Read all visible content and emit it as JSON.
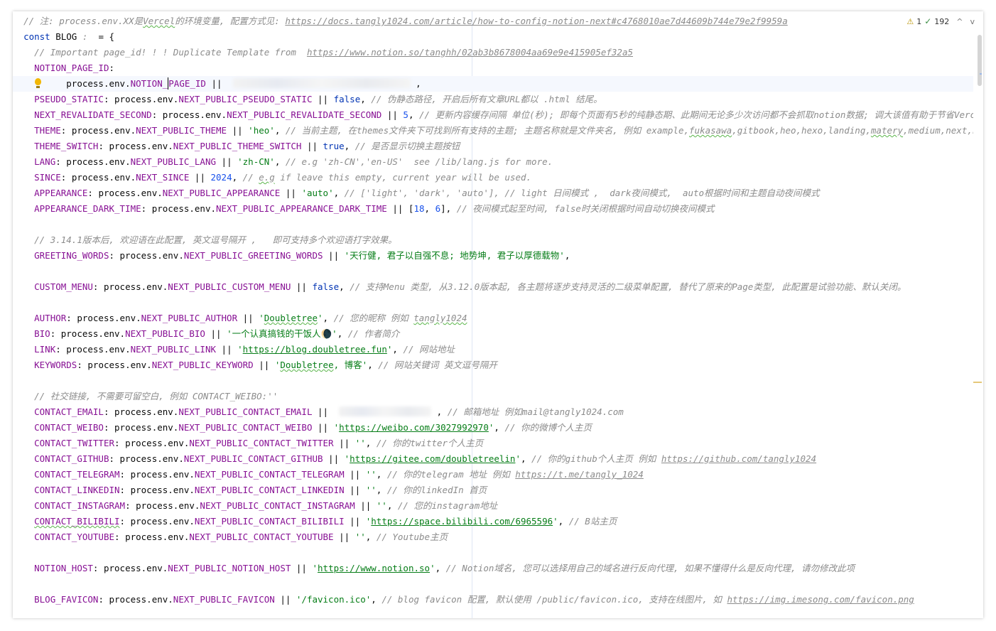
{
  "inspection": {
    "warnings": "1",
    "weak_warnings": "192",
    "prev_label": "^",
    "next_label": "v"
  },
  "lines": [
    [
      [
        "c",
        "// 注: process.env.XX是"
      ],
      [
        "c sq",
        "Vercel"
      ],
      [
        "c",
        "的环境变量, 配置方式见: "
      ],
      [
        "c u",
        "https://docs.tangly1024.com/article/how-to-config-notion-next#c4768010ae7d44609b744e79e2f9959a"
      ]
    ],
    [
      [
        "k",
        "const "
      ],
      [
        "",
        "BLOG "
      ],
      [
        "c",
        ":  "
      ],
      [
        "",
        "= {"
      ]
    ],
    [
      [
        "",
        "  "
      ],
      [
        "c",
        "// Important page_id! ! ! Duplicate Template from  "
      ],
      [
        "c u",
        "https://www.notion.so/tanghh/02ab3b8678004aa69e9e415905ef32a5"
      ]
    ],
    [
      [
        "",
        "  "
      ],
      [
        "p",
        "NOTION_PAGE_ID"
      ],
      [
        "",
        ":"
      ]
    ],
    [
      [
        "",
        "        process.env."
      ],
      [
        "p",
        "NOTION_"
      ],
      [
        "caret",
        ""
      ],
      [
        "p",
        "PAGE_ID"
      ],
      [
        "",
        " ||  "
      ],
      [
        "blur",
        ""
      ],
      [
        "",
        " ,"
      ]
    ],
    [
      [
        "",
        "  "
      ],
      [
        "p",
        "PSEUDO_STATIC"
      ],
      [
        "",
        ": process.env."
      ],
      [
        "p",
        "NEXT_PUBLIC_PSEUDO_STATIC"
      ],
      [
        "",
        " || "
      ],
      [
        "k",
        "false"
      ],
      [
        "",
        ", "
      ],
      [
        "c",
        "// 伪静态路径, 开启后所有文章URL都以 .html 结尾。"
      ]
    ],
    [
      [
        "",
        "  "
      ],
      [
        "p",
        "NEXT_REVALIDATE_SECOND"
      ],
      [
        "",
        ": process.env."
      ],
      [
        "p",
        "NEXT_PUBLIC_REVALIDATE_SECOND"
      ],
      [
        "",
        " || "
      ],
      [
        "n",
        "5"
      ],
      [
        "",
        ", "
      ],
      [
        "c",
        "// 更新内容缓存间隔 单位(秒); 即每个页面有5秒的纯静态期、此期间无论多少次访问都不会抓取notion数据; 调大该值有助于节省Vercel资源、同时提升访问速率, 但也会使文章更新有延迟。"
      ]
    ],
    [
      [
        "",
        "  "
      ],
      [
        "p",
        "THEME"
      ],
      [
        "",
        ": process.env."
      ],
      [
        "p",
        "NEXT_PUBLIC_THEME"
      ],
      [
        "",
        " || "
      ],
      [
        "s",
        "'heo'"
      ],
      [
        "",
        ", "
      ],
      [
        "c",
        "// 当前主题, 在themes文件夹下可找到所有支持的主题; 主题名称就是文件夹名, 例如 example,"
      ],
      [
        "c sq",
        "fukasawa"
      ],
      [
        "c",
        ",gitbook,heo,hexo,landing,"
      ],
      [
        "c sq",
        "matery"
      ],
      [
        "c",
        ",medium,next,nobelium,plog,simple"
      ]
    ],
    [
      [
        "",
        "  "
      ],
      [
        "p",
        "THEME_SWITCH"
      ],
      [
        "",
        ": process.env."
      ],
      [
        "p",
        "NEXT_PUBLIC_THEME_SWITCH"
      ],
      [
        "",
        " || "
      ],
      [
        "k",
        "true"
      ],
      [
        "",
        ", "
      ],
      [
        "c",
        "// 是否显示切换主题按钮"
      ]
    ],
    [
      [
        "",
        "  "
      ],
      [
        "p",
        "LANG"
      ],
      [
        "",
        ": process.env."
      ],
      [
        "p",
        "NEXT_PUBLIC_LANG"
      ],
      [
        "",
        " || "
      ],
      [
        "s",
        "'zh-CN'"
      ],
      [
        "",
        ", "
      ],
      [
        "c",
        "// e.g 'zh-CN','en-US'  see /lib/lang.js for more."
      ]
    ],
    [
      [
        "",
        "  "
      ],
      [
        "p",
        "SINCE"
      ],
      [
        "",
        ": process.env."
      ],
      [
        "p",
        "NEXT_SINCE"
      ],
      [
        "",
        " || "
      ],
      [
        "n",
        "2024"
      ],
      [
        "",
        ", "
      ],
      [
        "c",
        "// "
      ],
      [
        "c sq",
        "e.g"
      ],
      [
        "c",
        " if leave this empty, current year will be used."
      ]
    ],
    [
      [
        "",
        "  "
      ],
      [
        "p",
        "APPEARANCE"
      ],
      [
        "",
        ": process.env."
      ],
      [
        "p",
        "NEXT_PUBLIC_APPEARANCE"
      ],
      [
        "",
        " || "
      ],
      [
        "s",
        "'auto'"
      ],
      [
        "",
        ", "
      ],
      [
        "c",
        "// ['light', 'dark', 'auto'], // light 日间模式 ,  dark夜间模式,  auto根据时间和主题自动夜间模式"
      ]
    ],
    [
      [
        "",
        "  "
      ],
      [
        "p",
        "APPEARANCE_DARK_TIME"
      ],
      [
        "",
        ": process.env."
      ],
      [
        "p",
        "NEXT_PUBLIC_APPEARANCE_DARK_TIME"
      ],
      [
        "",
        " || ["
      ],
      [
        "n",
        "18"
      ],
      [
        "",
        ", "
      ],
      [
        "n",
        "6"
      ],
      [
        "",
        "], "
      ],
      [
        "c",
        "// 夜间模式起至时间, false时关闭根据时间自动切换夜间模式"
      ]
    ],
    [],
    [
      [
        "",
        "  "
      ],
      [
        "c",
        "// 3.14.1版本后, 欢迎语在此配置, 英文逗号隔开 ,   即可支持多个欢迎语打字效果。"
      ]
    ],
    [
      [
        "",
        "  "
      ],
      [
        "p",
        "GREETING_WORDS"
      ],
      [
        "",
        ": process.env."
      ],
      [
        "p",
        "NEXT_PUBLIC_GREETING_WORDS"
      ],
      [
        "",
        " || "
      ],
      [
        "s",
        "'天行健, 君子以自强不息; 地势坤, 君子以厚德载物'"
      ],
      [
        "",
        ","
      ]
    ],
    [],
    [
      [
        "",
        "  "
      ],
      [
        "p",
        "CUSTOM_MENU"
      ],
      [
        "",
        ": process.env."
      ],
      [
        "p",
        "NEXT_PUBLIC_CUSTOM_MENU"
      ],
      [
        "",
        " || "
      ],
      [
        "k",
        "false"
      ],
      [
        "",
        ", "
      ],
      [
        "c",
        "// 支持Menu 类型, 从3.12.0版本起, 各主题将逐步支持灵活的二级菜单配置, 替代了原来的Page类型, 此配置是试验功能、默认关闭。"
      ]
    ],
    [],
    [
      [
        "",
        "  "
      ],
      [
        "p",
        "AUTHOR"
      ],
      [
        "",
        ": process.env."
      ],
      [
        "p",
        "NEXT_PUBLIC_AUTHOR"
      ],
      [
        "",
        " || "
      ],
      [
        "s",
        "'"
      ],
      [
        "s sq",
        "Doubletree"
      ],
      [
        "s",
        "'"
      ],
      [
        "",
        ", "
      ],
      [
        "c",
        "// 您的昵称 例如 "
      ],
      [
        "c sq",
        "tangly1024"
      ]
    ],
    [
      [
        "",
        "  "
      ],
      [
        "p",
        "BIO"
      ],
      [
        "",
        ": process.env."
      ],
      [
        "p",
        "NEXT_PUBLIC_BIO"
      ],
      [
        "",
        " || "
      ],
      [
        "s",
        "'一个认真搞钱的干饭人🌘'"
      ],
      [
        "",
        ", "
      ],
      [
        "c",
        "// 作者简介"
      ]
    ],
    [
      [
        "",
        "  "
      ],
      [
        "p",
        "LINK"
      ],
      [
        "",
        ": process.env."
      ],
      [
        "p",
        "NEXT_PUBLIC_LINK"
      ],
      [
        "",
        " || "
      ],
      [
        "s",
        "'"
      ],
      [
        "s u",
        "https://blog.doubletree.fun"
      ],
      [
        "s",
        "'"
      ],
      [
        "",
        ", "
      ],
      [
        "c",
        "// 网站地址"
      ]
    ],
    [
      [
        "",
        "  "
      ],
      [
        "p",
        "KEYWORDS"
      ],
      [
        "",
        ": process.env."
      ],
      [
        "p",
        "NEXT_PUBLIC_KEYWORD"
      ],
      [
        "",
        " || "
      ],
      [
        "s",
        "'"
      ],
      [
        "s sq",
        "Doubletree"
      ],
      [
        "s",
        ", 博客'"
      ],
      [
        "",
        ", "
      ],
      [
        "c",
        "// 网站关键词 英文逗号隔开"
      ]
    ],
    [],
    [
      [
        "",
        "  "
      ],
      [
        "c",
        "// 社交链接, 不需要可留空白, 例如 CONTACT_WEIBO:''"
      ]
    ],
    [
      [
        "",
        "  "
      ],
      [
        "p",
        "CONTACT_EMAIL"
      ],
      [
        "",
        ": process.env."
      ],
      [
        "p",
        "NEXT_PUBLIC_CONTACT_EMAIL"
      ],
      [
        "",
        " ||  "
      ],
      [
        "blur short",
        ""
      ],
      [
        "",
        " , "
      ],
      [
        "c",
        "// 邮箱地址 例如mail@tangly1024.com"
      ]
    ],
    [
      [
        "",
        "  "
      ],
      [
        "p",
        "CONTACT_WEIBO"
      ],
      [
        "",
        ": process.env."
      ],
      [
        "p",
        "NEXT_PUBLIC_CONTACT_WEIBO"
      ],
      [
        "",
        " || "
      ],
      [
        "s",
        "'"
      ],
      [
        "s u",
        "https://weibo.com/3027992970"
      ],
      [
        "s",
        "'"
      ],
      [
        "",
        ", "
      ],
      [
        "c",
        "// 你的微博个人主页"
      ]
    ],
    [
      [
        "",
        "  "
      ],
      [
        "p",
        "CONTACT_TWITTER"
      ],
      [
        "",
        ": process.env."
      ],
      [
        "p",
        "NEXT_PUBLIC_CONTACT_TWITTER"
      ],
      [
        "",
        " || "
      ],
      [
        "s",
        "''"
      ],
      [
        "",
        ", "
      ],
      [
        "c",
        "// 你的twitter个人主页"
      ]
    ],
    [
      [
        "",
        "  "
      ],
      [
        "p",
        "CONTACT_GITHUB"
      ],
      [
        "",
        ": process.env."
      ],
      [
        "p",
        "NEXT_PUBLIC_CONTACT_GITHUB"
      ],
      [
        "",
        " || "
      ],
      [
        "s",
        "'"
      ],
      [
        "s u",
        "https://gitee.com/doubletreelin"
      ],
      [
        "s",
        "'"
      ],
      [
        "",
        ", "
      ],
      [
        "c",
        "// 你的github个人主页 例如 "
      ],
      [
        "c u",
        "https://github.com/tangly1024"
      ]
    ],
    [
      [
        "",
        "  "
      ],
      [
        "p",
        "CONTACT_TELEGRAM"
      ],
      [
        "",
        ": process.env."
      ],
      [
        "p",
        "NEXT_PUBLIC_CONTACT_TELEGRAM"
      ],
      [
        "",
        " || "
      ],
      [
        "s",
        "''"
      ],
      [
        "",
        ", "
      ],
      [
        "c",
        "// 你的telegram 地址 例如 "
      ],
      [
        "c u",
        "https://t.me/tangly_1024"
      ]
    ],
    [
      [
        "",
        "  "
      ],
      [
        "p",
        "CONTACT_LINKEDIN"
      ],
      [
        "",
        ": process.env."
      ],
      [
        "p",
        "NEXT_PUBLIC_CONTACT_LINKEDIN"
      ],
      [
        "",
        " || "
      ],
      [
        "s",
        "''"
      ],
      [
        "",
        ", "
      ],
      [
        "c",
        "// 你的linkedIn 首页"
      ]
    ],
    [
      [
        "",
        "  "
      ],
      [
        "p",
        "CONTACT_INSTAGRAM"
      ],
      [
        "",
        ": process.env."
      ],
      [
        "p",
        "NEXT_PUBLIC_CONTACT_INSTAGRAM"
      ],
      [
        "",
        " || "
      ],
      [
        "s",
        "''"
      ],
      [
        "",
        ", "
      ],
      [
        "c",
        "// 您的instagram地址"
      ]
    ],
    [
      [
        "",
        "  "
      ],
      [
        "p sq",
        "CONTACT_BILIBILI"
      ],
      [
        "",
        ": process.env."
      ],
      [
        "p",
        "NEXT_PUBLIC_CONTACT_BILIBILI"
      ],
      [
        "",
        " || "
      ],
      [
        "s",
        "'"
      ],
      [
        "s u",
        "https://space.bilibili.com/6965596"
      ],
      [
        "s",
        "'"
      ],
      [
        "",
        ", "
      ],
      [
        "c",
        "// B站主页"
      ]
    ],
    [
      [
        "",
        "  "
      ],
      [
        "p",
        "CONTACT_YOUTUBE"
      ],
      [
        "",
        ": process.env."
      ],
      [
        "p",
        "NEXT_PUBLIC_CONTACT_YOUTUBE"
      ],
      [
        "",
        " || "
      ],
      [
        "s",
        "''"
      ],
      [
        "",
        ", "
      ],
      [
        "c",
        "// Youtube主页"
      ]
    ],
    [],
    [
      [
        "",
        "  "
      ],
      [
        "p",
        "NOTION_HOST"
      ],
      [
        "",
        ": process.env."
      ],
      [
        "p",
        "NEXT_PUBLIC_NOTION_HOST"
      ],
      [
        "",
        " || "
      ],
      [
        "s",
        "'"
      ],
      [
        "s u",
        "https://www.notion.so"
      ],
      [
        "s",
        "'"
      ],
      [
        "",
        ", "
      ],
      [
        "c",
        "// Notion域名, 您可以选择用自己的域名进行反向代理, 如果不懂得什么是反向代理, 请勿修改此项"
      ]
    ],
    [],
    [
      [
        "",
        "  "
      ],
      [
        "p",
        "BLOG_FAVICON"
      ],
      [
        "",
        ": process.env."
      ],
      [
        "p",
        "NEXT_PUBLIC_FAVICON"
      ],
      [
        "",
        " || "
      ],
      [
        "s",
        "'/favicon.ico'"
      ],
      [
        "",
        ", "
      ],
      [
        "c",
        "// blog favicon 配置, 默认使用 /public/favicon.ico, 支持在线图片, 如 "
      ],
      [
        "c u",
        "https://img.imesong.com/favicon.png"
      ]
    ]
  ]
}
